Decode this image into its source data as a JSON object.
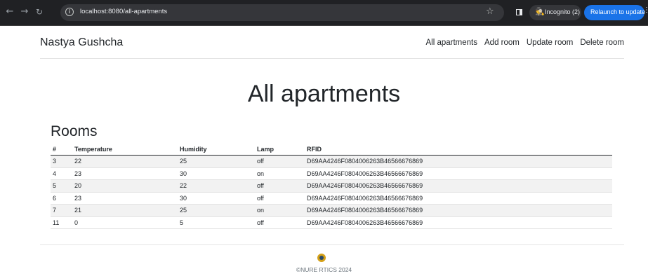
{
  "browser": {
    "url": "localhost:8080/all-apartments",
    "incognito_label": "Incognito (2)",
    "relaunch_label": "Relaunch to update",
    "back_glyph": "←",
    "forward_glyph": "→",
    "reload_glyph": "↻",
    "star_glyph": "☆",
    "info_glyph": "i",
    "menu_glyph": "⋮",
    "incognito_glyph": "🕵"
  },
  "header": {
    "brand": "Nastya Gushcha",
    "nav": [
      "All apartments",
      "Add room",
      "Update room",
      "Delete room"
    ]
  },
  "page": {
    "title": "All apartments",
    "section_title": "Rooms"
  },
  "table": {
    "columns": [
      "#",
      "Temperature",
      "Humidity",
      "Lamp",
      "RFID"
    ],
    "rows": [
      [
        "3",
        "22",
        "25",
        "off",
        "D69AA4246F0804006263B46566676869"
      ],
      [
        "4",
        "23",
        "30",
        "on",
        "D69AA4246F0804006263B46566676869"
      ],
      [
        "5",
        "20",
        "22",
        "off",
        "D69AA4246F0804006263B46566676869"
      ],
      [
        "6",
        "23",
        "30",
        "off",
        "D69AA4246F0804006263B46566676869"
      ],
      [
        "7",
        "21",
        "25",
        "on",
        "D69AA4246F0804006263B46566676869"
      ],
      [
        "11",
        "0",
        "5",
        "off",
        "D69AA4246F0804006263B46566676869"
      ]
    ]
  },
  "footer": {
    "text": "©NURE RTICS 2024"
  },
  "colors": {
    "chrome_bg": "#202124",
    "relaunch_blue": "#1a73e8",
    "stripe": "#f2f2f2"
  }
}
